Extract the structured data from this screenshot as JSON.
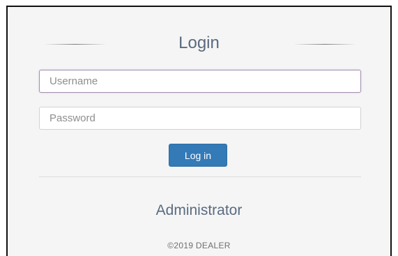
{
  "login_form": {
    "title": "Login",
    "username": {
      "value": "",
      "placeholder": "Username"
    },
    "password": {
      "value": "",
      "placeholder": "Password"
    },
    "submit_label": "Log in"
  },
  "footer": {
    "role_label": "Administrator",
    "copyright": "©2019 DEALER"
  },
  "colors": {
    "primary_button": "#337ab7",
    "heading_text": "#5a6b80",
    "focused_border": "#a58fb0"
  }
}
